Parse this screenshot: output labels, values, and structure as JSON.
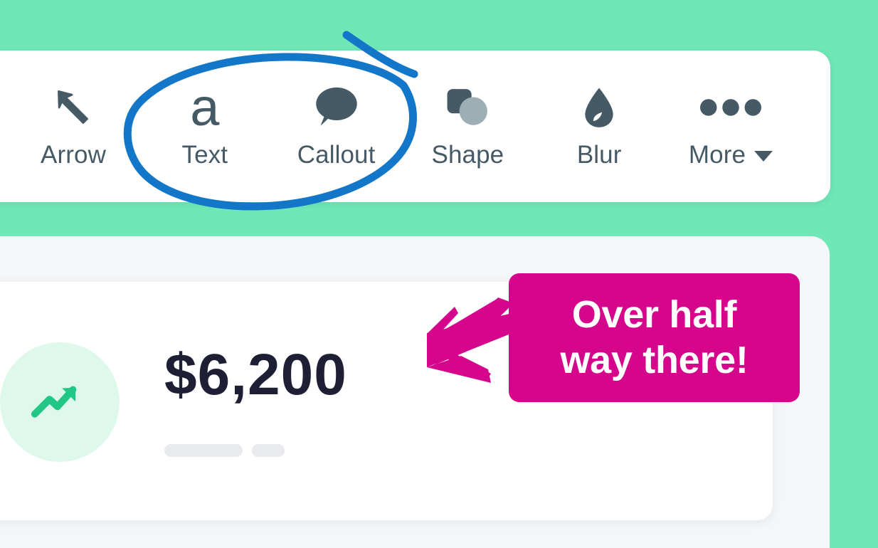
{
  "canvas": {
    "background_color": "#6FE7B7"
  },
  "toolbar": {
    "background_color": "#FFFFFF",
    "icon_color": "#455A64",
    "tools": [
      {
        "label": "Arrow",
        "icon": "arrow-up-left-icon",
        "has_caret": false
      },
      {
        "label": "Text",
        "icon": "text-letter-a-icon",
        "has_caret": false
      },
      {
        "label": "Callout",
        "icon": "speech-bubble-icon",
        "has_caret": false
      },
      {
        "label": "Shape",
        "icon": "square-circle-icon",
        "has_caret": false
      },
      {
        "label": "Blur",
        "icon": "water-droplet-icon",
        "has_caret": false
      },
      {
        "label": "More",
        "icon": "ellipsis-horizontal-icon",
        "has_caret": true
      }
    ]
  },
  "annotations": {
    "circle": {
      "shape": "hand-drawn-ellipse",
      "color": "#1277C8",
      "encircles": [
        "Text",
        "Callout"
      ]
    },
    "callout": {
      "text_line_1": "Over half",
      "text_line_2": "way there!",
      "background_color": "#D5058C",
      "text_color": "#FFFFFF",
      "arrow": {
        "shape": "hand-drawn-left-arrow",
        "color": "#D5058C",
        "direction": "left",
        "points_at": "stat-value"
      }
    }
  },
  "panel": {
    "background_color": "#F4F6F9"
  },
  "stat_card": {
    "background_color": "#FFFFFF",
    "icon": "trending-up-icon",
    "icon_color": "#22C686",
    "icon_circle_color": "#DFF8EC",
    "value": "$6,200",
    "value_color": "#1E1F35",
    "placeholder_bars": 2,
    "placeholder_color": "#E8EAEE"
  }
}
